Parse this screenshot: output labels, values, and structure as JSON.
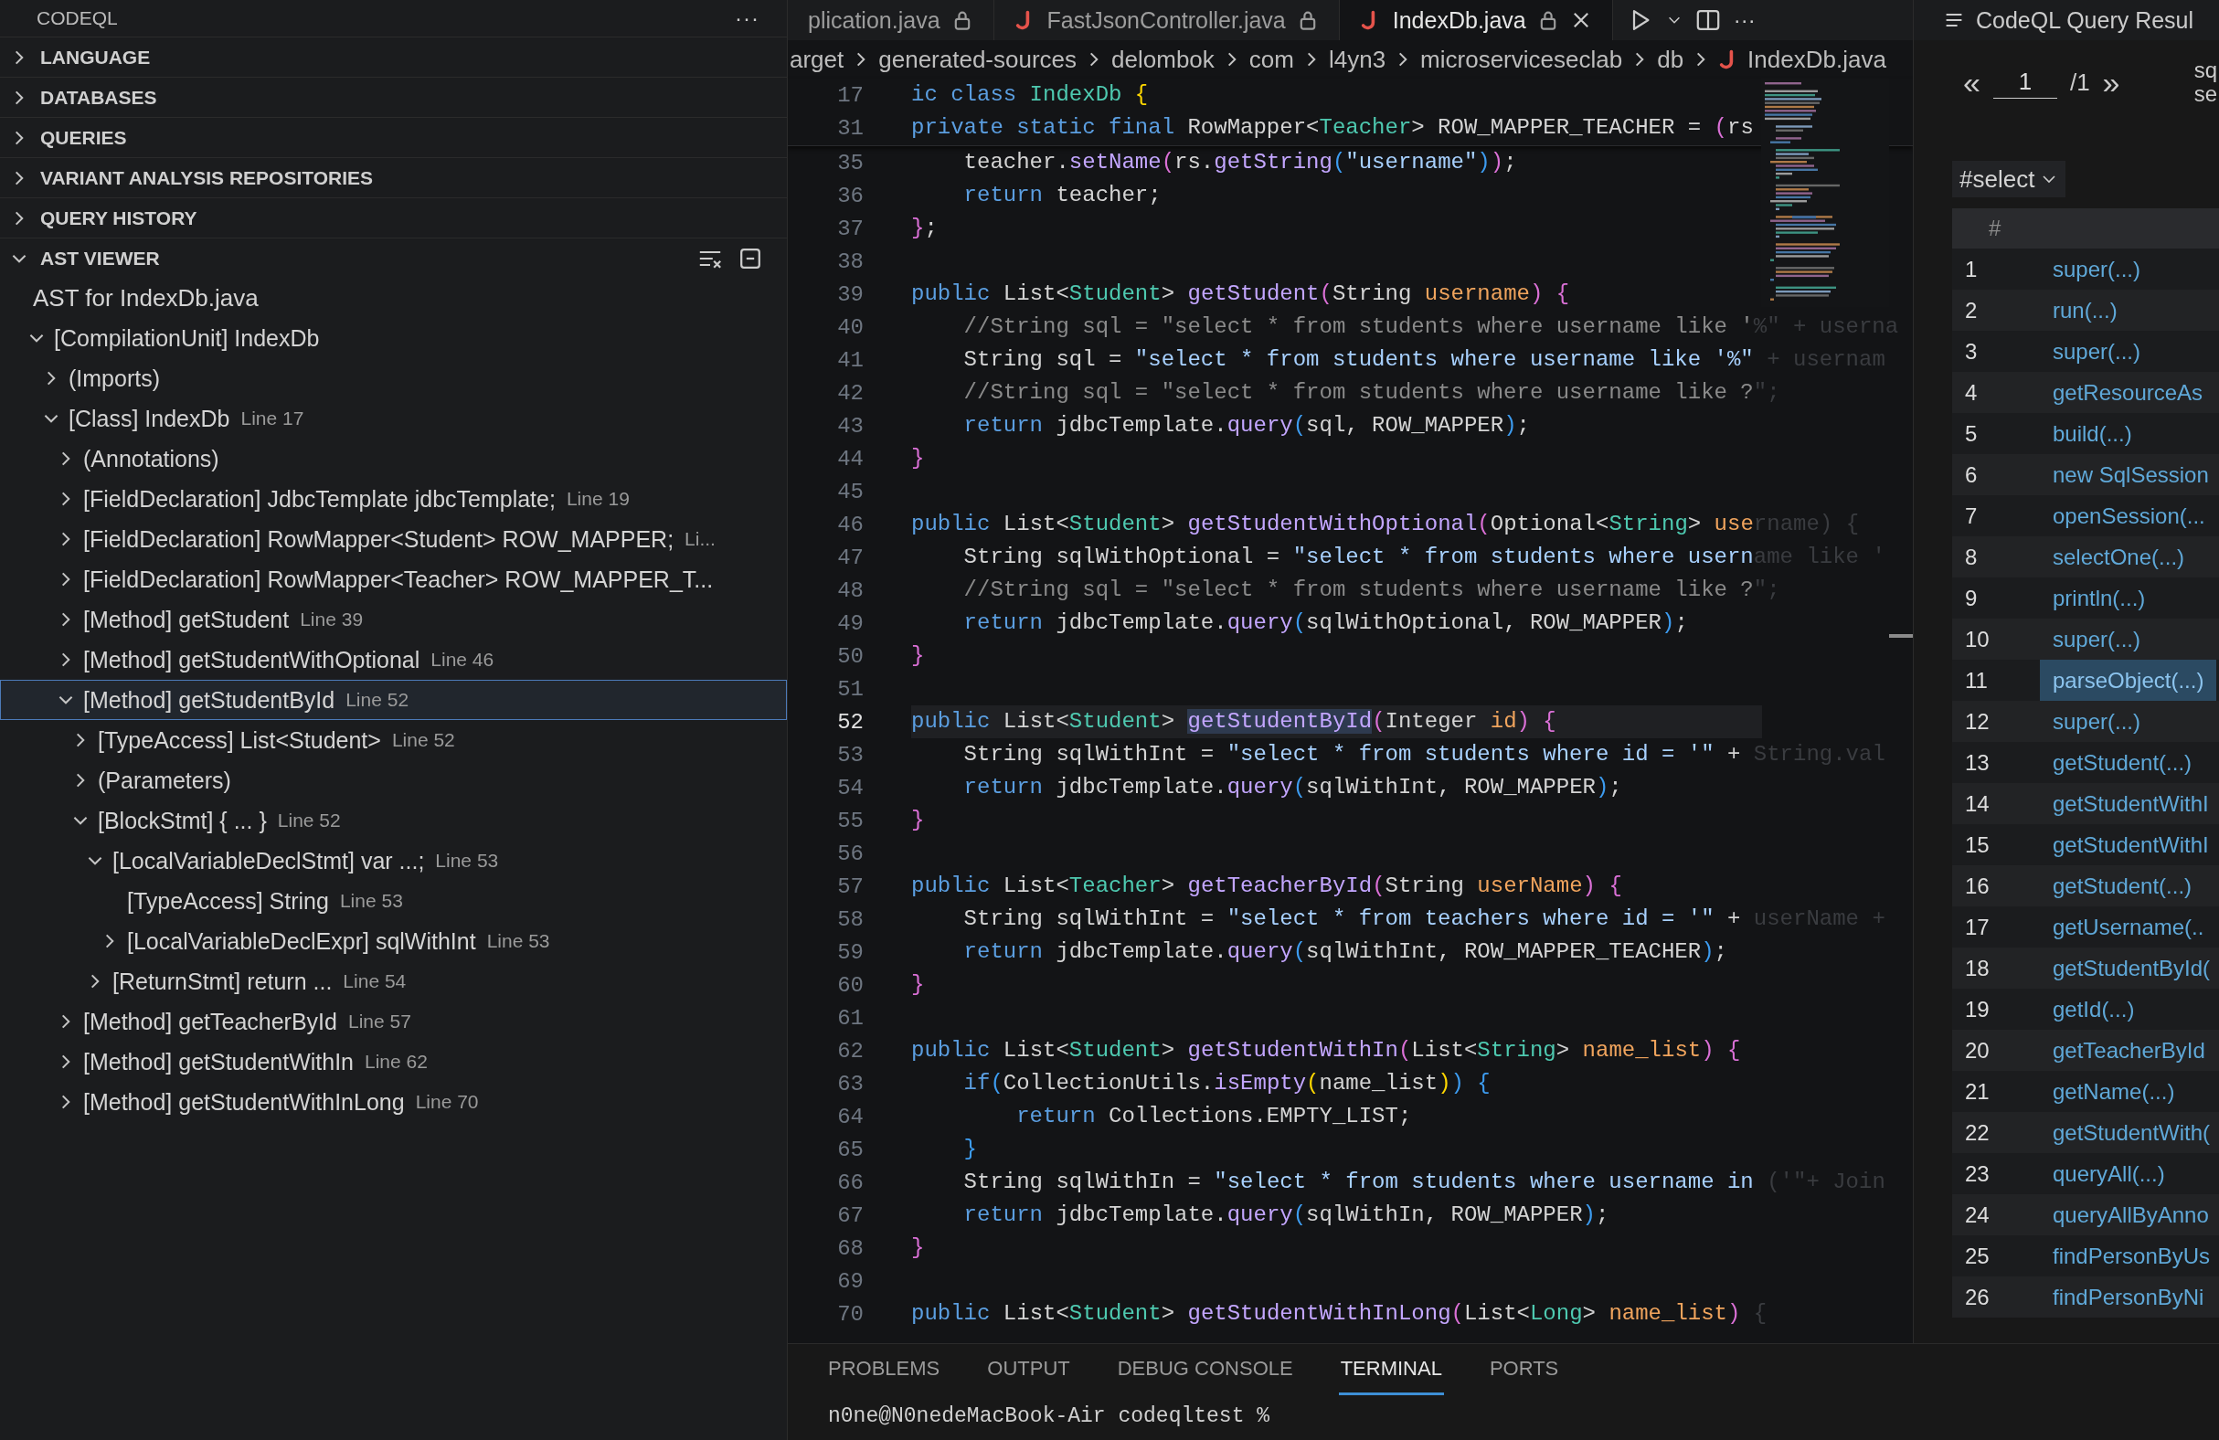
{
  "sidebar": {
    "title": "CODEQL",
    "more": "···",
    "sections": [
      {
        "title": "LANGUAGE",
        "expanded": false
      },
      {
        "title": "DATABASES",
        "expanded": false
      },
      {
        "title": "QUERIES",
        "expanded": false
      },
      {
        "title": "VARIANT ANALYSIS REPOSITORIES",
        "expanded": false
      },
      {
        "title": "QUERY HISTORY",
        "expanded": false
      }
    ],
    "ast_viewer": {
      "title": "AST VIEWER",
      "expanded": true,
      "heading": "AST for IndexDb.java",
      "tree": [
        {
          "label": "[CompilationUnit] IndexDb",
          "kind": "branch",
          "expanded": true,
          "selected": false,
          "children": [
            {
              "label": "(Imports)",
              "kind": "branch",
              "expanded": false,
              "selected": false
            },
            {
              "label": "[Class] IndexDb",
              "detail": "Line 17",
              "kind": "branch",
              "expanded": true,
              "selected": false,
              "children": [
                {
                  "label": "(Annotations)",
                  "kind": "branch",
                  "expanded": false,
                  "selected": false
                },
                {
                  "label": "[FieldDeclaration] JdbcTemplate jdbcTemplate;",
                  "detail": "Line 19",
                  "kind": "branch",
                  "expanded": false,
                  "selected": false
                },
                {
                  "label": "[FieldDeclaration] RowMapper<Student> ROW_MAPPER;",
                  "detail": "Li...",
                  "kind": "branch",
                  "expanded": false,
                  "selected": false
                },
                {
                  "label": "[FieldDeclaration] RowMapper<Teacher> ROW_MAPPER_T...",
                  "kind": "branch",
                  "expanded": false,
                  "selected": false
                },
                {
                  "label": "[Method] getStudent",
                  "detail": "Line 39",
                  "kind": "branch",
                  "expanded": false,
                  "selected": false
                },
                {
                  "label": "[Method] getStudentWithOptional",
                  "detail": "Line 46",
                  "kind": "branch",
                  "expanded": false,
                  "selected": false
                },
                {
                  "label": "[Method] getStudentById",
                  "detail": "Line 52",
                  "kind": "branch",
                  "expanded": true,
                  "selected": true,
                  "children": [
                    {
                      "label": "[TypeAccess] List<Student>",
                      "detail": "Line 52",
                      "kind": "branch",
                      "expanded": false,
                      "selected": false
                    },
                    {
                      "label": "(Parameters)",
                      "kind": "branch",
                      "expanded": false,
                      "selected": false
                    },
                    {
                      "label": "[BlockStmt] { ... }",
                      "detail": "Line 52",
                      "kind": "branch",
                      "expanded": true,
                      "selected": false,
                      "children": [
                        {
                          "label": "[LocalVariableDeclStmt] var ...;",
                          "detail": "Line 53",
                          "kind": "branch",
                          "expanded": true,
                          "selected": false,
                          "children": [
                            {
                              "label": "[TypeAccess] String",
                              "detail": "Line 53",
                              "kind": "leaf",
                              "selected": false
                            },
                            {
                              "label": "[LocalVariableDeclExpr] sqlWithInt",
                              "detail": "Line 53",
                              "kind": "branch",
                              "expanded": false,
                              "selected": false
                            }
                          ]
                        },
                        {
                          "label": "[ReturnStmt] return ...",
                          "detail": "Line 54",
                          "kind": "branch",
                          "expanded": false,
                          "selected": false
                        }
                      ]
                    }
                  ]
                },
                {
                  "label": "[Method] getTeacherById",
                  "detail": "Line 57",
                  "kind": "branch",
                  "expanded": false,
                  "selected": false
                },
                {
                  "label": "[Method] getStudentWithIn",
                  "detail": "Line 62",
                  "kind": "branch",
                  "expanded": false,
                  "selected": false
                },
                {
                  "label": "[Method] getStudentWithInLong",
                  "detail": "Line 70",
                  "kind": "branch",
                  "expanded": false,
                  "selected": false
                }
              ]
            }
          ]
        }
      ]
    }
  },
  "editor": {
    "tabs": [
      {
        "label": "plication.java",
        "kind": "plain",
        "selected": false
      },
      {
        "label": "FastJsonController.java",
        "kind": "java",
        "selected": false
      },
      {
        "label": "IndexDb.java",
        "kind": "java",
        "selected": true
      }
    ],
    "more": "···",
    "breadcrumbs": [
      {
        "label": "arget",
        "kind": "folder"
      },
      {
        "label": "generated-sources",
        "kind": "folder"
      },
      {
        "label": "delombok",
        "kind": "folder"
      },
      {
        "label": "com",
        "kind": "folder"
      },
      {
        "label": "l4yn3",
        "kind": "folder"
      },
      {
        "label": "microserviceseclab",
        "kind": "folder"
      },
      {
        "label": "db",
        "kind": "folder"
      },
      {
        "label": "IndexDb.java",
        "kind": "java"
      }
    ],
    "sticky_lines": [
      {
        "n": "17",
        "tokens": [
          {
            "text": "ic class",
            "kind": "kw"
          },
          {
            "text": " IndexDb",
            "kind": "ty"
          },
          {
            "text": " {",
            "kind": "b3"
          }
        ]
      },
      {
        "n": "31",
        "tokens": [
          {
            "text": "private static final",
            "kind": "kw"
          },
          {
            "text": " RowMapper<"
          },
          {
            "text": "Teacher",
            "kind": "ty"
          },
          {
            "text": "> ROW_MAPPER_TEACHER = "
          },
          {
            "text": "(",
            "kind": "b1"
          },
          {
            "text": "rs"
          }
        ]
      }
    ],
    "lines": [
      {
        "n": "35",
        "current": false,
        "tokens": [
          {
            "text": "    teacher."
          },
          {
            "text": "setName",
            "kind": "fn"
          },
          {
            "text": "(",
            "kind": "b1"
          },
          {
            "text": "rs."
          },
          {
            "text": "getString",
            "kind": "fn"
          },
          {
            "text": "(",
            "kind": "b2"
          },
          {
            "text": "\"username\"",
            "kind": "str"
          },
          {
            "text": ")",
            "kind": "b2"
          },
          {
            "text": ")",
            "kind": "b1"
          },
          {
            "text": ";"
          }
        ]
      },
      {
        "n": "36",
        "current": false,
        "tokens": [
          {
            "text": "    return",
            "kind": "kw"
          },
          {
            "text": " teacher;"
          }
        ]
      },
      {
        "n": "37",
        "current": false,
        "tokens": [
          {
            "text": "}",
            "kind": "b1"
          },
          {
            "text": ";"
          }
        ]
      },
      {
        "n": "38",
        "current": false
      },
      {
        "n": "39",
        "current": false,
        "tokens": [
          {
            "text": "public",
            "kind": "kw"
          },
          {
            "text": " List<"
          },
          {
            "text": "Student",
            "kind": "ty"
          },
          {
            "text": "> "
          },
          {
            "text": "getStudent",
            "kind": "fn"
          },
          {
            "text": "(",
            "kind": "b1"
          },
          {
            "text": "String "
          },
          {
            "text": "username",
            "kind": "pm"
          },
          {
            "text": ")",
            "kind": "b1"
          },
          {
            "text": " {",
            "kind": "b1"
          }
        ]
      },
      {
        "n": "40",
        "current": false,
        "tokens": [
          {
            "text": "    //String sql = \"select * from students where username like '",
            "kind": "cm"
          },
          {
            "text": "%\" + userna",
            "kind": "gh"
          }
        ]
      },
      {
        "n": "41",
        "current": false,
        "tokens": [
          {
            "text": "    String sql = "
          },
          {
            "text": "\"select * from students where username like '%\"",
            "kind": "str"
          },
          {
            "text": " + usernam",
            "kind": "gh"
          }
        ]
      },
      {
        "n": "42",
        "current": false,
        "tokens": [
          {
            "text": "    //String sql = \"select * from students where username like ?",
            "kind": "cm"
          },
          {
            "text": "\";",
            "kind": "gh"
          }
        ]
      },
      {
        "n": "43",
        "current": false,
        "tokens": [
          {
            "text": "    return",
            "kind": "kw"
          },
          {
            "text": " jdbcTemplate."
          },
          {
            "text": "query",
            "kind": "fn"
          },
          {
            "text": "(",
            "kind": "b2"
          },
          {
            "text": "sql, ROW_MAPPER"
          },
          {
            "text": ")",
            "kind": "b2"
          },
          {
            "text": ";"
          }
        ]
      },
      {
        "n": "44",
        "current": false,
        "tokens": [
          {
            "text": "}",
            "kind": "b1"
          }
        ]
      },
      {
        "n": "45",
        "current": false
      },
      {
        "n": "46",
        "current": false,
        "tokens": [
          {
            "text": "public",
            "kind": "kw"
          },
          {
            "text": " List<"
          },
          {
            "text": "Student",
            "kind": "ty"
          },
          {
            "text": "> "
          },
          {
            "text": "getStudentWithOptional",
            "kind": "fn"
          },
          {
            "text": "(",
            "kind": "b1"
          },
          {
            "text": "Optional<"
          },
          {
            "text": "String",
            "kind": "ty"
          },
          {
            "text": "> "
          },
          {
            "text": "use",
            "kind": "pm"
          },
          {
            "text": "rname) {",
            "kind": "gh"
          }
        ]
      },
      {
        "n": "47",
        "current": false,
        "tokens": [
          {
            "text": "    String sqlWithOptional = "
          },
          {
            "text": "\"select * from students where usern",
            "kind": "str"
          },
          {
            "text": "ame like '",
            "kind": "gh"
          }
        ]
      },
      {
        "n": "48",
        "current": false,
        "tokens": [
          {
            "text": "    //String sql = \"select * from students where username like ?",
            "kind": "cm"
          },
          {
            "text": "\";",
            "kind": "gh"
          }
        ]
      },
      {
        "n": "49",
        "current": false,
        "tokens": [
          {
            "text": "    return",
            "kind": "kw"
          },
          {
            "text": " jdbcTemplate."
          },
          {
            "text": "query",
            "kind": "fn"
          },
          {
            "text": "(",
            "kind": "b2"
          },
          {
            "text": "sqlWithOptional, ROW_MAPPER"
          },
          {
            "text": ")",
            "kind": "b2"
          },
          {
            "text": ";"
          }
        ]
      },
      {
        "n": "50",
        "current": false,
        "tokens": [
          {
            "text": "}",
            "kind": "b1"
          }
        ]
      },
      {
        "n": "51",
        "current": false
      },
      {
        "n": "52",
        "current": true,
        "tokens": [
          {
            "text": "public",
            "kind": "kw"
          },
          {
            "text": " List<"
          },
          {
            "text": "Student",
            "kind": "ty"
          },
          {
            "text": "> "
          },
          {
            "text": "getStudentById",
            "kind": "hl"
          },
          {
            "text": "(",
            "kind": "b1"
          },
          {
            "text": "Integer "
          },
          {
            "text": "id",
            "kind": "pm"
          },
          {
            "text": ")",
            "kind": "b1"
          },
          {
            "text": " {",
            "kind": "b1"
          }
        ]
      },
      {
        "n": "53",
        "current": false,
        "tokens": [
          {
            "text": "    String sqlWithInt = "
          },
          {
            "text": "\"select * from students where id = '\"",
            "kind": "str"
          },
          {
            "text": " + "
          },
          {
            "text": "String.val",
            "kind": "gh"
          }
        ]
      },
      {
        "n": "54",
        "current": false,
        "tokens": [
          {
            "text": "    return",
            "kind": "kw"
          },
          {
            "text": " jdbcTemplate."
          },
          {
            "text": "query",
            "kind": "fn"
          },
          {
            "text": "(",
            "kind": "b2"
          },
          {
            "text": "sqlWithInt, ROW_MAPPER"
          },
          {
            "text": ")",
            "kind": "b2"
          },
          {
            "text": ";"
          }
        ]
      },
      {
        "n": "55",
        "current": false,
        "tokens": [
          {
            "text": "}",
            "kind": "b1"
          }
        ]
      },
      {
        "n": "56",
        "current": false
      },
      {
        "n": "57",
        "current": false,
        "tokens": [
          {
            "text": "public",
            "kind": "kw"
          },
          {
            "text": " List<"
          },
          {
            "text": "Teacher",
            "kind": "ty"
          },
          {
            "text": "> "
          },
          {
            "text": "getTeacherById",
            "kind": "fn"
          },
          {
            "text": "(",
            "kind": "b1"
          },
          {
            "text": "String "
          },
          {
            "text": "userName",
            "kind": "pm"
          },
          {
            "text": ")",
            "kind": "b1"
          },
          {
            "text": " {",
            "kind": "b1"
          }
        ]
      },
      {
        "n": "58",
        "current": false,
        "tokens": [
          {
            "text": "    String sqlWithInt = "
          },
          {
            "text": "\"select * from teachers where id = '\"",
            "kind": "str"
          },
          {
            "text": " + "
          },
          {
            "text": "userName +",
            "kind": "gh"
          }
        ]
      },
      {
        "n": "59",
        "current": false,
        "tokens": [
          {
            "text": "    return",
            "kind": "kw"
          },
          {
            "text": " jdbcTemplate."
          },
          {
            "text": "query",
            "kind": "fn"
          },
          {
            "text": "(",
            "kind": "b2"
          },
          {
            "text": "sqlWithInt, ROW_MAPPER_TEACHER"
          },
          {
            "text": ")",
            "kind": "b2"
          },
          {
            "text": ";"
          }
        ]
      },
      {
        "n": "60",
        "current": false,
        "tokens": [
          {
            "text": "}",
            "kind": "b1"
          }
        ]
      },
      {
        "n": "61",
        "current": false
      },
      {
        "n": "62",
        "current": false,
        "tokens": [
          {
            "text": "public",
            "kind": "kw"
          },
          {
            "text": " List<"
          },
          {
            "text": "Student",
            "kind": "ty"
          },
          {
            "text": "> "
          },
          {
            "text": "getStudentWithIn",
            "kind": "fn"
          },
          {
            "text": "(",
            "kind": "b1"
          },
          {
            "text": "List<"
          },
          {
            "text": "String",
            "kind": "ty"
          },
          {
            "text": "> "
          },
          {
            "text": "name_list",
            "kind": "pm"
          },
          {
            "text": ")",
            "kind": "b1"
          },
          {
            "text": " {",
            "kind": "b1"
          }
        ]
      },
      {
        "n": "63",
        "current": false,
        "tokens": [
          {
            "text": "    if",
            "kind": "kw"
          },
          {
            "text": "(",
            "kind": "b2"
          },
          {
            "text": "CollectionUtils."
          },
          {
            "text": "isEmpty",
            "kind": "fn"
          },
          {
            "text": "(",
            "kind": "b3"
          },
          {
            "text": "name_list"
          },
          {
            "text": ")",
            "kind": "b3"
          },
          {
            "text": ")",
            "kind": "b2"
          },
          {
            "text": " {",
            "kind": "b2"
          }
        ]
      },
      {
        "n": "64",
        "current": false,
        "tokens": [
          {
            "text": "        return",
            "kind": "kw"
          },
          {
            "text": " Collections.EMPTY_LIST;"
          }
        ]
      },
      {
        "n": "65",
        "current": false,
        "tokens": [
          {
            "text": "    }",
            "kind": "b2"
          }
        ]
      },
      {
        "n": "66",
        "current": false,
        "tokens": [
          {
            "text": "    String sqlWithIn = "
          },
          {
            "text": "\"select * from students where username in ",
            "kind": "str"
          },
          {
            "text": "('\"+ Join",
            "kind": "gh"
          }
        ]
      },
      {
        "n": "67",
        "current": false,
        "tokens": [
          {
            "text": "    return",
            "kind": "kw"
          },
          {
            "text": " jdbcTemplate."
          },
          {
            "text": "query",
            "kind": "fn"
          },
          {
            "text": "(",
            "kind": "b2"
          },
          {
            "text": "sqlWithIn, ROW_MAPPER"
          },
          {
            "text": ")",
            "kind": "b2"
          },
          {
            "text": ";"
          }
        ]
      },
      {
        "n": "68",
        "current": false,
        "tokens": [
          {
            "text": "}",
            "kind": "b1"
          }
        ]
      },
      {
        "n": "69",
        "current": false
      },
      {
        "n": "70",
        "current": false,
        "tokens": [
          {
            "text": "public",
            "kind": "kw"
          },
          {
            "text": " List<"
          },
          {
            "text": "Student",
            "kind": "ty"
          },
          {
            "text": "> "
          },
          {
            "text": "getStudentWithInLong",
            "kind": "fn"
          },
          {
            "text": "(",
            "kind": "b1"
          },
          {
            "text": "List<"
          },
          {
            "text": "Long",
            "kind": "ty"
          },
          {
            "text": "> "
          },
          {
            "text": "name_list",
            "kind": "pm"
          },
          {
            "text": ")",
            "kind": "b1"
          },
          {
            "text": " {",
            "kind": "gh"
          }
        ]
      }
    ]
  },
  "results": {
    "title": "CodeQL Query Resul",
    "pager": {
      "prev": "«",
      "page": "1",
      "total": "/1",
      "next": "»"
    },
    "side_text": [
      "sq",
      "se"
    ],
    "result_set": "#select",
    "column": "#",
    "rows": [
      {
        "n": "1",
        "text": "super(...)",
        "selected": false
      },
      {
        "n": "2",
        "text": "run(...)",
        "selected": false
      },
      {
        "n": "3",
        "text": "super(...)",
        "selected": false
      },
      {
        "n": "4",
        "text": "getResourceAs",
        "selected": false
      },
      {
        "n": "5",
        "text": "build(...)",
        "selected": false
      },
      {
        "n": "6",
        "text": "new SqlSession",
        "selected": false
      },
      {
        "n": "7",
        "text": "openSession(...",
        "selected": false
      },
      {
        "n": "8",
        "text": "selectOne(...)",
        "selected": false
      },
      {
        "n": "9",
        "text": "println(...)",
        "selected": false
      },
      {
        "n": "10",
        "text": "super(...)",
        "selected": false
      },
      {
        "n": "11",
        "text": "parseObject(...)",
        "selected": true
      },
      {
        "n": "12",
        "text": "super(...)",
        "selected": false
      },
      {
        "n": "13",
        "text": "getStudent(...)",
        "selected": false
      },
      {
        "n": "14",
        "text": "getStudentWithI",
        "selected": false
      },
      {
        "n": "15",
        "text": "getStudentWithI",
        "selected": false
      },
      {
        "n": "16",
        "text": "getStudent(...)",
        "selected": false
      },
      {
        "n": "17",
        "text": "getUsername(..",
        "selected": false
      },
      {
        "n": "18",
        "text": "getStudentById(",
        "selected": false
      },
      {
        "n": "19",
        "text": "getId(...)",
        "selected": false
      },
      {
        "n": "20",
        "text": "getTeacherById",
        "selected": false
      },
      {
        "n": "21",
        "text": "getName(...)",
        "selected": false
      },
      {
        "n": "22",
        "text": "getStudentWith(",
        "selected": false
      },
      {
        "n": "23",
        "text": "queryAll(...)",
        "selected": false
      },
      {
        "n": "24",
        "text": "queryAllByAnno",
        "selected": false
      },
      {
        "n": "25",
        "text": "findPersonByUs",
        "selected": false
      },
      {
        "n": "26",
        "text": "findPersonByNi",
        "selected": false
      }
    ]
  },
  "panel": {
    "tabs": [
      {
        "label": "PROBLEMS",
        "selected": false
      },
      {
        "label": "OUTPUT",
        "selected": false
      },
      {
        "label": "DEBUG CONSOLE",
        "selected": false
      },
      {
        "label": "TERMINAL",
        "selected": true
      },
      {
        "label": "PORTS",
        "selected": false
      }
    ],
    "terminal": "n0ne@N0nedeMacBook-Air codeqltest %"
  }
}
